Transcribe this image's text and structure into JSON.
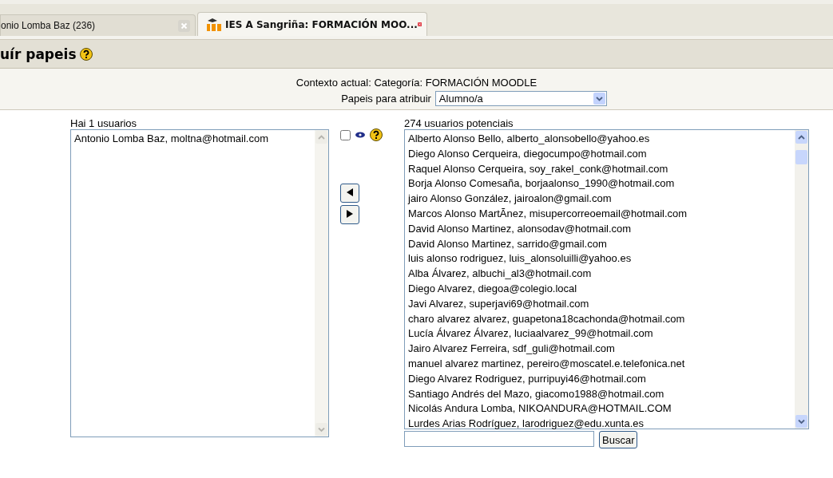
{
  "tabs": [
    {
      "label": "onio Lomba Baz (236)",
      "selected": false
    },
    {
      "label": "IES A Sangriña: FORMACIÓN MOO...",
      "selected": true
    }
  ],
  "heading": "uír papeis",
  "context": "Contexto actual: Categoría: FORMACIÓN MOODLE",
  "role": {
    "label": "Papeis para atribuir",
    "value": "Alumno/a"
  },
  "existing": {
    "title": "Hai 1 usuarios",
    "users": [
      "Antonio Lomba Baz, moltna@hotmail.com"
    ]
  },
  "show_all": {
    "checked": false
  },
  "potential": {
    "title": "274 usuarios potenciais",
    "users": [
      "Alberto Alonso Bello, alberto_alonsobello@yahoo.es",
      "Diego Alonso Cerqueira, diegocumpo@hotmail.com",
      "Raquel Alonso Cerqueira, soy_rakel_conk@hotmail.com",
      "Borja Alonso Comesaña, borjaalonso_1990@hotmail.com",
      "jairo Alonso González, jairoalon@gmail.com",
      "Marcos Alonso MartÃnez, misupercorreoemail@hotmail.com",
      "David Alonso Martinez, alonsodav@hotmail.com",
      "David Alonso Martinez, sarrido@gmail.com",
      "luis alonso rodriguez, luis_alonsoluilli@yahoo.es",
      "Alba Álvarez, albuchi_al3@hotmail.com",
      "Diego Alvarez, diegoa@colegio.local",
      "Javi Alvarez, superjavi69@hotmail.com",
      "charo alvarez alvarez, guapetona18cachonda@hotmail.com",
      "Lucía Álvarez Álvarez, luciaalvarez_99@hotmail.com",
      "Jairo Alvarez Ferreira, sdf_guli@hotmail.com",
      "manuel alvarez martinez, pereiro@moscatel.e.telefonica.net",
      "Diego Alvarez Rodriguez, purripuyi46@hotmail.com",
      "Santiago Andrés del Mazo, giacomo1988@hotmail.com",
      "Nicolás Andura Lomba, NIKOANDURA@HOTMAIL.COM",
      "Lurdes Arias Rodríguez, larodriguez@edu.xunta.es"
    ]
  },
  "search_button": "Buscar"
}
